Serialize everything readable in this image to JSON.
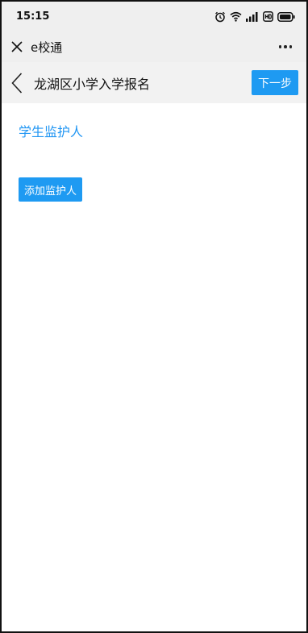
{
  "status_bar": {
    "time": "15:15",
    "icons": [
      "alarm-icon",
      "wifi-icon",
      "signal-icon",
      "hd-icon",
      "battery-icon"
    ]
  },
  "app_bar": {
    "title": "e校通",
    "close_icon": "close-icon",
    "more_icon": "more-icon"
  },
  "page_nav": {
    "title": "龙湖区小学入学报名",
    "next_label": "下一步",
    "back_icon": "chevron-left-icon"
  },
  "main": {
    "section_heading": "学生监护人",
    "add_guardian_label": "添加监护人"
  },
  "colors": {
    "accent": "#1e9af2",
    "heading": "#2196f3",
    "bar_bg": "#efefef"
  }
}
